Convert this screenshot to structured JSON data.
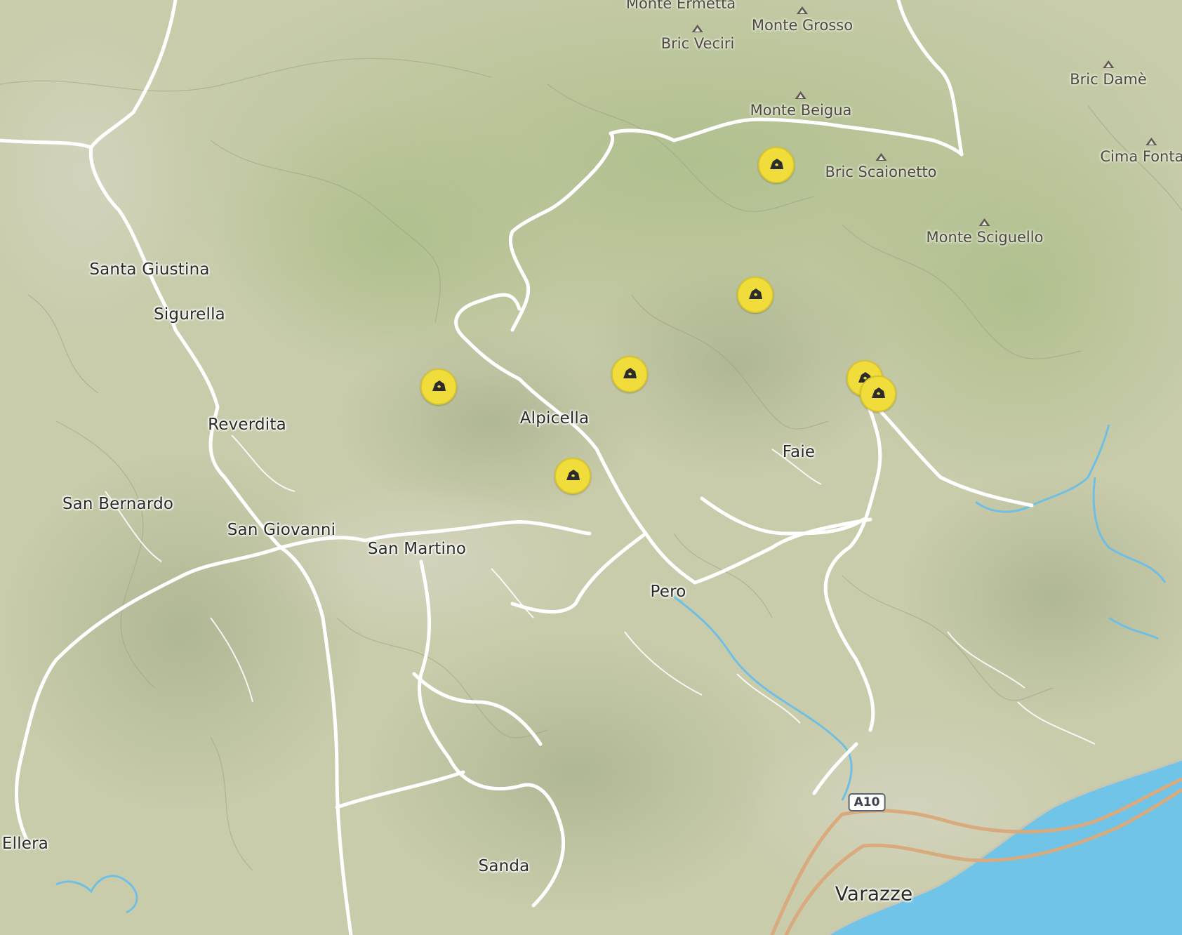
{
  "map": {
    "places": [
      {
        "name": "Santa Giustina",
        "size": "normal"
      },
      {
        "name": "Sigurella",
        "size": "normal"
      },
      {
        "name": "Reverdita",
        "size": "normal"
      },
      {
        "name": "San Bernardo",
        "size": "normal"
      },
      {
        "name": "San Giovanni",
        "size": "normal"
      },
      {
        "name": "San Martino",
        "size": "normal"
      },
      {
        "name": "Alpicella",
        "size": "normal"
      },
      {
        "name": "Faie",
        "size": "normal"
      },
      {
        "name": "Pero",
        "size": "normal"
      },
      {
        "name": "Sanda",
        "size": "normal"
      },
      {
        "name": "Ellera",
        "size": "normal"
      },
      {
        "name": "Varazze",
        "size": "big"
      }
    ],
    "peaks": [
      {
        "name": "Monte Ermetta"
      },
      {
        "name": "Monte Grosso"
      },
      {
        "name": "Bric Veciri"
      },
      {
        "name": "Bric Damè"
      },
      {
        "name": "Monte Beigua"
      },
      {
        "name": "Bric Scaionetto"
      },
      {
        "name": "Cima Fontana"
      },
      {
        "name": "Monte Sciguello"
      }
    ],
    "road_shield": "A10",
    "poi_icon": "climbing-crag-icon",
    "poi_count": 7,
    "colors": {
      "terrain": "#c9ccab",
      "forest": "#b6c898",
      "road": "#ffffff",
      "motorway": "#d9aa7d",
      "water": "#70c4e8",
      "poi": "#f0dc3a"
    }
  }
}
